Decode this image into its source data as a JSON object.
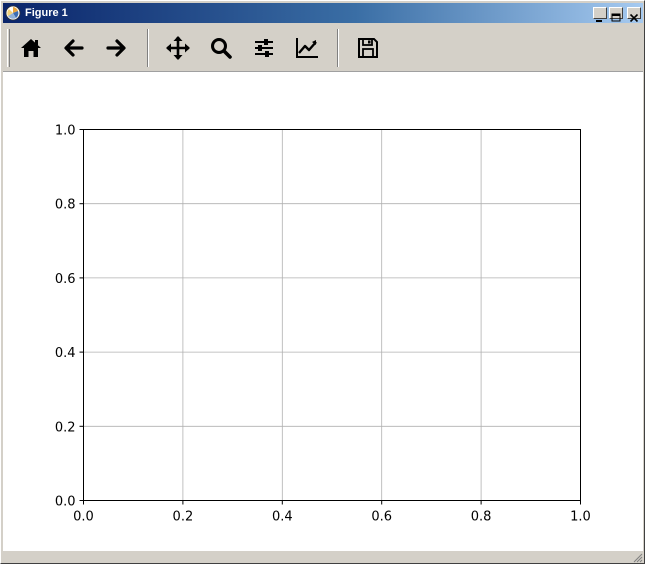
{
  "window": {
    "title": "Figure 1"
  },
  "toolbar": {
    "buttons": [
      {
        "name": "home",
        "icon": "home-icon"
      },
      {
        "name": "back",
        "icon": "arrow-left-icon"
      },
      {
        "name": "forward",
        "icon": "arrow-right-icon"
      },
      {
        "name": "pan",
        "icon": "move-arrows-icon"
      },
      {
        "name": "zoom",
        "icon": "magnifier-icon"
      },
      {
        "name": "subplots",
        "icon": "sliders-icon"
      },
      {
        "name": "customize",
        "icon": "line-chart-icon"
      },
      {
        "name": "save",
        "icon": "floppy-disk-icon"
      }
    ]
  },
  "chart_data": {
    "type": "line",
    "title": "",
    "xlabel": "",
    "ylabel": "",
    "xlim": [
      0.0,
      1.0
    ],
    "ylim": [
      0.0,
      1.0
    ],
    "xticks": [
      "0.0",
      "0.2",
      "0.4",
      "0.6",
      "0.8",
      "1.0"
    ],
    "yticks": [
      "0.0",
      "0.2",
      "0.4",
      "0.6",
      "0.8",
      "1.0"
    ],
    "grid": true,
    "series": []
  },
  "colors": {
    "titlebar_start": "#0a246a",
    "titlebar_end": "#a6caf0",
    "grid": "#b0b0b0",
    "axes": "#000000"
  }
}
